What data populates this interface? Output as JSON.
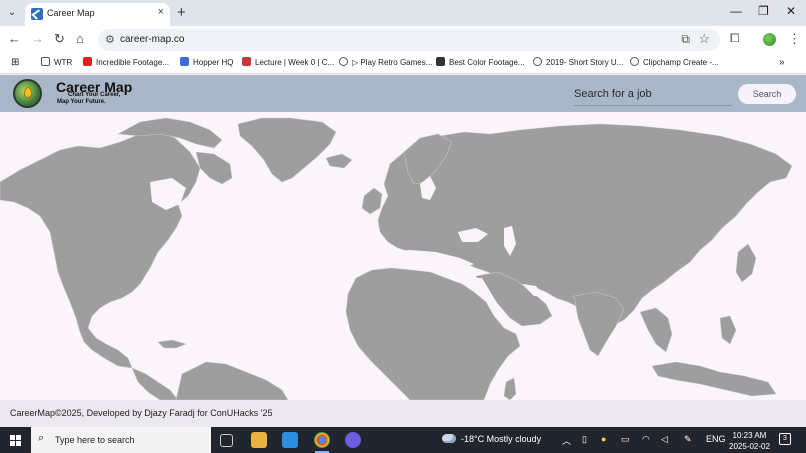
{
  "browser": {
    "tab_title": "Career Map",
    "tab_close": "×",
    "new_tab": "+",
    "url": "career-map.co",
    "window": {
      "minimize": "—",
      "restore": "❐",
      "close": "✕"
    }
  },
  "bookmarks": [
    {
      "label": "WTR",
      "icon": "folder-icon",
      "color": "#555555"
    },
    {
      "label": "Incredible Footage...",
      "icon": "youtube-icon",
      "color": "#e02020"
    },
    {
      "label": "Hopper HQ",
      "icon": "hopper-icon",
      "color": "#3b6fd8"
    },
    {
      "label": "Lecture | Week 0 | C...",
      "icon": "edx-icon",
      "color": "#c8373c"
    },
    {
      "label": "▷ Play Retro Games...",
      "icon": "globe-icon",
      "color": "#555555"
    },
    {
      "label": "Best Color Footage...",
      "icon": "film-icon",
      "color": "#333333"
    },
    {
      "label": "2019- Short Story U...",
      "icon": "globe-icon",
      "color": "#555555"
    },
    {
      "label": "Clipchamp Create -...",
      "icon": "globe-icon",
      "color": "#555555"
    }
  ],
  "app": {
    "name": "Career Map",
    "tagline_1": "Chart Your Career,",
    "tagline_2": "Map Your Future.",
    "search_placeholder": "Search for a job",
    "search_button": "Search",
    "accent": "#aab7c8",
    "land_color": "#9e9e9e",
    "ocean_color": "#fbf5fb"
  },
  "footer": {
    "text": "CareerMap©2025, Developed by Djazy Faradj for ConUHacks '25"
  },
  "taskbar": {
    "search_placeholder": "Type here to search",
    "weather": "-18°C  Mostly cloudy",
    "language": "ENG",
    "time": "10:23 AM",
    "date": "2025-02-02",
    "notifications": "3"
  }
}
